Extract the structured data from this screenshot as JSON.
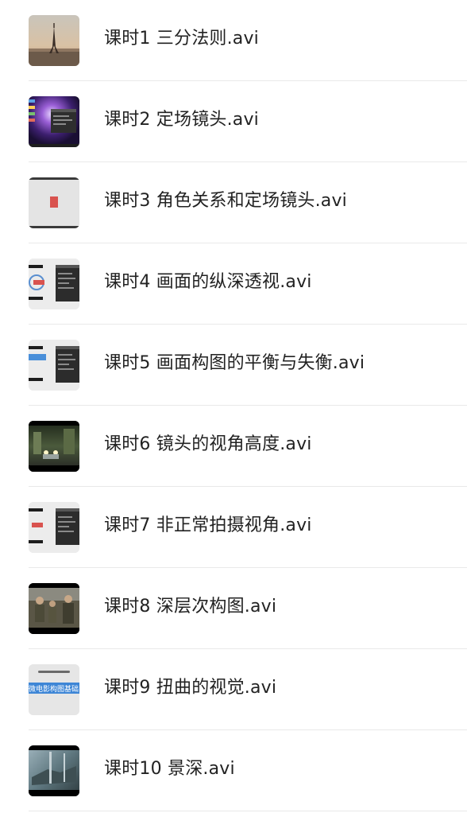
{
  "files": [
    {
      "name": "课时1 三分法则.avi",
      "thumbnail": "paris-eiffel-tower-thumbnail"
    },
    {
      "name": "课时2 定场镜头.avi",
      "thumbnail": "desktop-screenshot-thumbnail"
    },
    {
      "name": "课时3 角色关系和定场镜头.avi",
      "thumbnail": "gray-slide-thumbnail"
    },
    {
      "name": "课时4 画面的纵深透视.avi",
      "thumbnail": "software-screenshot-thumbnail"
    },
    {
      "name": "课时5 画面构图的平衡与失衡.avi",
      "thumbnail": "software-screenshot-thumbnail"
    },
    {
      "name": "课时6 镜头的视角高度.avi",
      "thumbnail": "night-street-thumbnail"
    },
    {
      "name": "课时7 非正常拍摄视角.avi",
      "thumbnail": "software-screenshot-thumbnail"
    },
    {
      "name": "课时8 深层次构图.avi",
      "thumbnail": "soldiers-film-still-thumbnail"
    },
    {
      "name": "课时9 扭曲的视觉.avi",
      "thumbnail": "blue-banner-slide-thumbnail",
      "thumbnail_text": "微电影构图基础"
    },
    {
      "name": "课时10 景深.avi",
      "thumbnail": "window-reflection-film-still-thumbnail"
    }
  ],
  "colors": {
    "label": "#222222",
    "divider": "#e9e9e9",
    "background": "#ffffff"
  }
}
